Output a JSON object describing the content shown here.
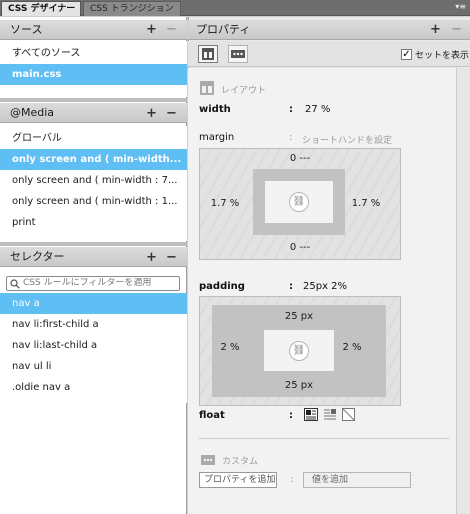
{
  "tabs": [
    {
      "label": "CSS デザイナー"
    },
    {
      "label": "CSS トランジション"
    }
  ],
  "panel_menu": "▾≡",
  "sources": {
    "title": "ソース",
    "add": "+",
    "remove": "−",
    "items": [
      "すべてのソース",
      "main.css"
    ],
    "selected": 1
  },
  "media": {
    "title": "@Media",
    "add": "+",
    "remove": "−",
    "items": [
      "グローバル",
      "only screen and ( min-width...",
      "only screen and ( min-width : 7...",
      "only screen and ( min-width : 1...",
      "print"
    ],
    "selected": 1
  },
  "selectors": {
    "title": "セレクター",
    "add": "+",
    "remove": "−",
    "search_placeholder": "CSS ルールにフィルターを適用",
    "items": [
      "nav a",
      "nav li:first-child a",
      "nav li:last-child a",
      "nav ul li",
      ".oldie nav a"
    ],
    "selected": 0
  },
  "properties": {
    "title": "プロパティ",
    "add": "+",
    "remove": "−",
    "show_set_label": "セットを表示",
    "show_set_checked": "✓",
    "layout_label": "レイアウト",
    "width_label": "width",
    "width_colon": ":",
    "width_value": "27 %",
    "margin_label": "margin",
    "margin_colon": ":",
    "margin_shorthand": "ショートハンドを設定",
    "margin_top": "0 ---",
    "margin_bottom": "0 ---",
    "margin_left": "1.7 %",
    "margin_right": "1.7 %",
    "padding_label": "padding",
    "padding_colon": ":",
    "padding_value": "25px 2%",
    "padding_top": "25 px",
    "padding_bottom": "25 px",
    "padding_left": "2 %",
    "padding_right": "2 %",
    "float_label": "float",
    "float_colon": ":",
    "custom_label": "カスタム",
    "custom_prop_placeholder": "プロパティを追加",
    "custom_colon": ":",
    "custom_value_placeholder": "値を追加"
  },
  "icons": {
    "add": "plus-icon",
    "remove": "minus-icon",
    "search": "search-icon",
    "link": "link-icon",
    "layout": "layout-icon",
    "more": "ellipsis-icon"
  },
  "colors": {
    "selection": "#5fbef3",
    "header": "#d2d2d2",
    "tabbar": "#6e6e6e"
  }
}
